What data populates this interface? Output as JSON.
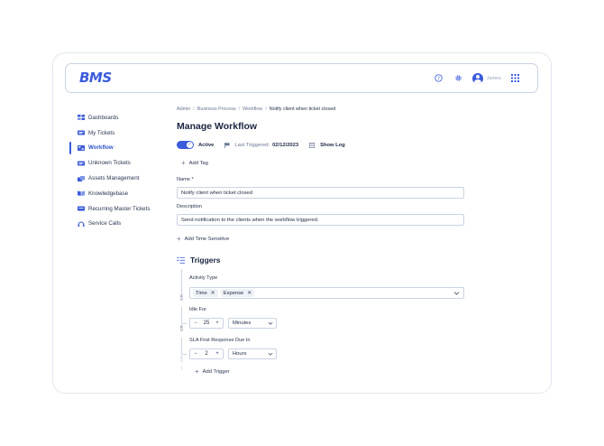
{
  "header": {
    "logo": "BMS",
    "user_name": "James"
  },
  "sidebar": {
    "items": [
      {
        "label": "Dashboards",
        "icon": "dashboard-icon"
      },
      {
        "label": "My Tickets",
        "icon": "ticket-icon"
      },
      {
        "label": "Workflow",
        "icon": "workflow-icon",
        "active": true
      },
      {
        "label": "Unknown Tickets",
        "icon": "ticket-icon"
      },
      {
        "label": "Assets Management",
        "icon": "assets-icon"
      },
      {
        "label": "Knowledgebase",
        "icon": "book-icon"
      },
      {
        "label": "Recurring Master Tickets",
        "icon": "recurring-icon"
      },
      {
        "label": "Service Calls",
        "icon": "headset-icon"
      }
    ]
  },
  "breadcrumb": {
    "items": [
      "Admin",
      "Business Process",
      "Workflow",
      "Notify client when ticket closed"
    ],
    "separator": "/"
  },
  "page": {
    "title": "Manage Workflow",
    "status_label": "Active",
    "last_triggered_label": "Last Triggered:",
    "last_triggered_value": "02/12/2023",
    "show_log": "Show Log",
    "add_tag": "Add Tag",
    "name_label": "Name *",
    "name_value": "Notify client when ticket closed",
    "description_label": "Description",
    "description_value": "Send notification to the clients when the workflow triggered.",
    "add_time_sensitive": "Add Time Sensitive"
  },
  "triggers": {
    "heading": "Triggers",
    "or_label": "OR",
    "activity_type_label": "Activity Type",
    "activity_chips": [
      "Time",
      "Expense"
    ],
    "idle_for_label": "Idle For",
    "idle_value": "25",
    "idle_unit": "Minutes",
    "sla_label": "SLA First Response Due In",
    "sla_value": "2",
    "sla_unit": "Hours",
    "minus": "−",
    "plus": "+",
    "add_trigger": "Add Trigger"
  },
  "colors": {
    "accent": "#3b5bdb",
    "border": "#c9d3e3",
    "text": "#1f2a44"
  }
}
